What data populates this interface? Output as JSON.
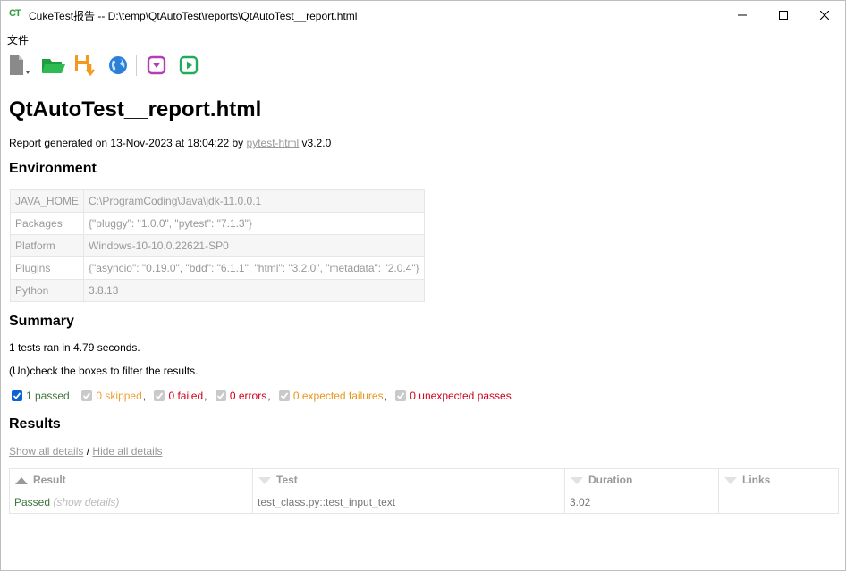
{
  "window": {
    "title": "CukeTest报告 -- D:\\temp\\QtAutoTest\\reports\\QtAutoTest__report.html",
    "logo_text": "CT"
  },
  "menu": {
    "file_label": "文件"
  },
  "toolbar": {
    "icons": [
      "new-file-icon",
      "open-folder-icon",
      "save-download-icon",
      "globe-icon",
      "collapse-icon",
      "play-icon"
    ]
  },
  "report": {
    "title": "QtAutoTest__report.html",
    "generated_prefix": "Report generated on 13-Nov-2023 at 18:04:22 by ",
    "generated_link": "pytest-html",
    "generated_suffix": " v3.2.0",
    "environment_heading": "Environment",
    "environment": [
      {
        "key": "JAVA_HOME",
        "value": "C:\\ProgramCoding\\Java\\jdk-11.0.0.1"
      },
      {
        "key": "Packages",
        "value": "{\"pluggy\": \"1.0.0\", \"pytest\": \"7.1.3\"}"
      },
      {
        "key": "Platform",
        "value": "Windows-10-10.0.22621-SP0"
      },
      {
        "key": "Plugins",
        "value": "{\"asyncio\": \"0.19.0\", \"bdd\": \"6.1.1\", \"html\": \"3.2.0\", \"metadata\": \"2.0.4\"}"
      },
      {
        "key": "Python",
        "value": "3.8.13"
      }
    ],
    "summary_heading": "Summary",
    "summary_line": "1 tests ran in 4.79 seconds.",
    "filter_hint": "(Un)check the boxes to filter the results.",
    "filters": {
      "passed": "1 passed",
      "skipped": "0 skipped",
      "failed": "0 failed",
      "errors": "0 errors",
      "xfailed": "0 expected failures",
      "xpassed": "0 unexpected passes"
    },
    "results_heading": "Results",
    "show_all": "Show all details",
    "divider": " / ",
    "hide_all": "Hide all details",
    "columns": {
      "result": "Result",
      "test": "Test",
      "duration": "Duration",
      "links": "Links"
    },
    "rows": [
      {
        "result": "Passed",
        "details": "(show details)",
        "test": "test_class.py::test_input_text",
        "duration": "3.02",
        "links": ""
      }
    ]
  },
  "colors": {
    "passed": "#3c763d",
    "failed": "#d0021b",
    "skipped": "#f0a030",
    "link_gray": "#999999"
  }
}
